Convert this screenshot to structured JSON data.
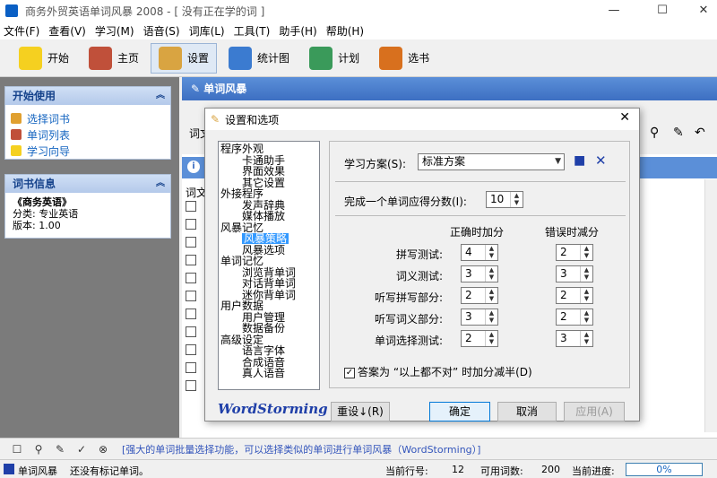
{
  "window": {
    "title": "商务外贸英语单词风暴 2008 - [ 没有正在学的词 ]"
  },
  "menu": [
    "文件(F)",
    "查看(V)",
    "学习(M)",
    "语音(S)",
    "词库(L)",
    "工具(T)",
    "助手(H)",
    "帮助(H)"
  ],
  "toolbar": [
    {
      "label": "开始",
      "icon": "lightbulb-icon",
      "color": "#f5d020"
    },
    {
      "label": "主页",
      "icon": "home-icon",
      "color": "#c0503a"
    },
    {
      "label": "设置",
      "icon": "wrench-icon",
      "color": "#d9a441"
    },
    {
      "label": "统计图",
      "icon": "chart-icon",
      "color": "#3b7bd0"
    },
    {
      "label": "计划",
      "icon": "plan-icon",
      "color": "#3a9a5a"
    },
    {
      "label": "选书",
      "icon": "books-icon",
      "color": "#d8701e"
    }
  ],
  "left_panel": {
    "start_title": "开始使用",
    "start_items": [
      "选择词书",
      "单词列表",
      "学习向导"
    ],
    "book_title": "词书信息",
    "book_name": "《商务英语》",
    "category": "分类: 专业英语",
    "version": "版本: 1.00"
  },
  "main": {
    "header": "单词风暴",
    "word_col": "词文",
    "partial_label": "词文"
  },
  "dialog": {
    "title": "设置和选项",
    "tree": [
      {
        "label": "程序外观",
        "level": 0
      },
      {
        "label": "卡通助手",
        "level": 1
      },
      {
        "label": "界面效果",
        "level": 1
      },
      {
        "label": "其它设置",
        "level": 1
      },
      {
        "label": "外接程序",
        "level": 0
      },
      {
        "label": "发声辞典",
        "level": 1
      },
      {
        "label": "媒体播放",
        "level": 1
      },
      {
        "label": "风暴记忆",
        "level": 0
      },
      {
        "label": "风暴策略",
        "level": 1,
        "selected": true
      },
      {
        "label": "风暴选项",
        "level": 1
      },
      {
        "label": "单词记忆",
        "level": 0
      },
      {
        "label": "浏览背单词",
        "level": 1
      },
      {
        "label": "对话背单词",
        "level": 1
      },
      {
        "label": "迷你背单词",
        "level": 1
      },
      {
        "label": "用户数据",
        "level": 0
      },
      {
        "label": "用户管理",
        "level": 1
      },
      {
        "label": "数据备份",
        "level": 1
      },
      {
        "label": "高级设定",
        "level": 0
      },
      {
        "label": "语言字体",
        "level": 1
      },
      {
        "label": "合成语音",
        "level": 1
      },
      {
        "label": "真人语音",
        "level": 1
      }
    ],
    "scheme_label": "学习方案(S):",
    "scheme_value": "标准方案",
    "score_label": "完成一个单词应得分数(I):",
    "score_value": "10",
    "col_correct": "正确时加分",
    "col_wrong": "错误时减分",
    "rows": [
      {
        "label": "拼写测试:",
        "correct": "4",
        "wrong": "2"
      },
      {
        "label": "词义测试:",
        "correct": "3",
        "wrong": "3"
      },
      {
        "label": "听写拼写部分:",
        "correct": "2",
        "wrong": "2"
      },
      {
        "label": "听写词义部分:",
        "correct": "3",
        "wrong": "2"
      },
      {
        "label": "单词选择测试:",
        "correct": "2",
        "wrong": "3"
      }
    ],
    "halve_label": "答案为 “以上都不对” 时加分减半(D)",
    "halve_checked": "✓",
    "logo": "WordStorming",
    "reset": "重设↓(R)",
    "ok": "确定",
    "cancel": "取消",
    "apply": "应用(A)"
  },
  "bottom_msg": "[强大的单词批量选择功能，可以选择类似的单词进行单词风暴（WordStorming）]",
  "status": {
    "mode": "单词风暴",
    "note": "还没有标记单词。",
    "row_label": "当前行号:",
    "row_value": "12",
    "count_label": "可用词数:",
    "count_value": "200",
    "progress_label": "当前进度:",
    "progress_value": "0%"
  }
}
